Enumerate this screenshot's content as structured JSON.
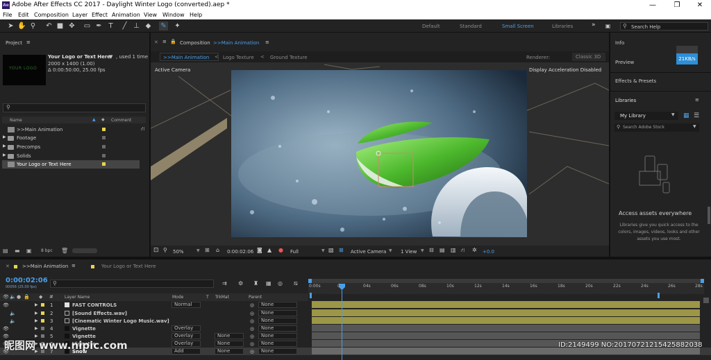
{
  "titlebar": {
    "icon": "Ae",
    "title": "Adobe After Effects CC 2017 - Daylight Winter Logo (converted).aep *",
    "minimize": "—",
    "maximize": "❐",
    "close": "✕"
  },
  "menu": [
    "File",
    "Edit",
    "Composition",
    "Layer",
    "Effect",
    "Animation",
    "View",
    "Window",
    "Help"
  ],
  "workspaces": {
    "default": "Default",
    "standard": "Standard",
    "small_screen": "Small Screen",
    "libraries": "Libraries",
    "more": "»",
    "search_placeholder": "Search Help"
  },
  "project": {
    "title": "Project",
    "item_name": "Your Logo or Text Here",
    "item_used": ", used 1 time",
    "item_size": "2000 x 1400 (1.00)",
    "item_duration": "Δ 0:00:50:00, 25.00 fps",
    "thumb_text": "YOUR LOGO",
    "col_name": "Name",
    "col_comment": "Comment",
    "bpc": "8 bpc",
    "items": [
      {
        "label": ">>Main Animation",
        "type": "comp",
        "color": "#e8d44d"
      },
      {
        "label": "Footage",
        "type": "folder",
        "color": "#6a6a6a"
      },
      {
        "label": "Precomps",
        "type": "folder",
        "color": "#6a6a6a"
      },
      {
        "label": "Solids",
        "type": "folder",
        "color": "#6a6a6a"
      },
      {
        "label": "Your Logo or Text Here",
        "type": "comp",
        "color": "#e8d44d"
      }
    ]
  },
  "composition": {
    "label": "Composition",
    "name": ">>Main Animation",
    "tabs": [
      ">>Main Animation",
      "Logo Texture",
      "Ground Texture"
    ],
    "renderer_label": "Renderer:",
    "renderer": "Classic 3D",
    "active_camera": "Active Camera",
    "accel": "Display Acceleration Disabled",
    "footer": {
      "zoom": "50%",
      "timecode": "0:00:02:06",
      "quality": "Full",
      "camera": "Active Camera",
      "view": "1 View",
      "exposure": "+0.0"
    }
  },
  "right_panels": {
    "info": "Info",
    "speed": "21KB/s",
    "preview": "Preview",
    "effects": "Effects & Presets",
    "libraries": "Libraries",
    "my_library": "My Library",
    "search_stock": "Search Adobe Stock",
    "access_title": "Access assets everywhere",
    "access_text": "Libraries give you quick access to the colors, images, videos, looks and other assets you use most."
  },
  "timeline": {
    "tab_main": ">>Main Animation",
    "tab_logo": "Your Logo or Text Here",
    "timecode": "0:00:02:06",
    "frames": "00056 (25.00 fps)",
    "col_layer": "Layer Name",
    "col_mode": "Mode",
    "col_t": "T",
    "col_trkmat": "TrkMat",
    "col_parent": "Parent",
    "ticks": [
      "0:00s",
      "02s",
      "04s",
      "06s",
      "08s",
      "10s",
      "12s",
      "14s",
      "16s",
      "18s",
      "20s",
      "22s",
      "24s",
      "26s",
      "28s"
    ],
    "layers": [
      {
        "num": "1",
        "name": "FAST CONTROLS",
        "mode": "Normal",
        "trkmat": "",
        "parent": "None",
        "color": "#e8d44d"
      },
      {
        "num": "2",
        "name": "[Sound Effects.wav]",
        "mode": "",
        "trkmat": "",
        "parent": "None",
        "color": "#e8d44d"
      },
      {
        "num": "3",
        "name": "[Cinematic Winter Logo Music.wav]",
        "mode": "",
        "trkmat": "",
        "parent": "None",
        "color": "#e8d44d"
      },
      {
        "num": "4",
        "name": "Vignette",
        "mode": "Overlay",
        "trkmat": "",
        "parent": "None",
        "color": "#777777"
      },
      {
        "num": "5",
        "name": "Vignette",
        "mode": "Overlay",
        "trkmat": "None",
        "parent": "None",
        "color": "#777777"
      },
      {
        "num": "6",
        "name": "Vignette",
        "mode": "Overlay",
        "trkmat": "None",
        "parent": "None",
        "color": "#777777"
      },
      {
        "num": "7",
        "name": "Snow",
        "mode": "Add",
        "trkmat": "None",
        "parent": "None",
        "color": "#777777"
      }
    ]
  },
  "watermark": {
    "logo": "昵图网 www.nipic.com",
    "id": "ID:2149499 NO:20170721215425882038"
  },
  "colors": {
    "accent": "#4a9fe8",
    "label_yellow": "#e8d44d",
    "bar_yellow": "#9c9647",
    "speed_bg": "#2d8fd8",
    "green_logo": "#5fc43a"
  }
}
